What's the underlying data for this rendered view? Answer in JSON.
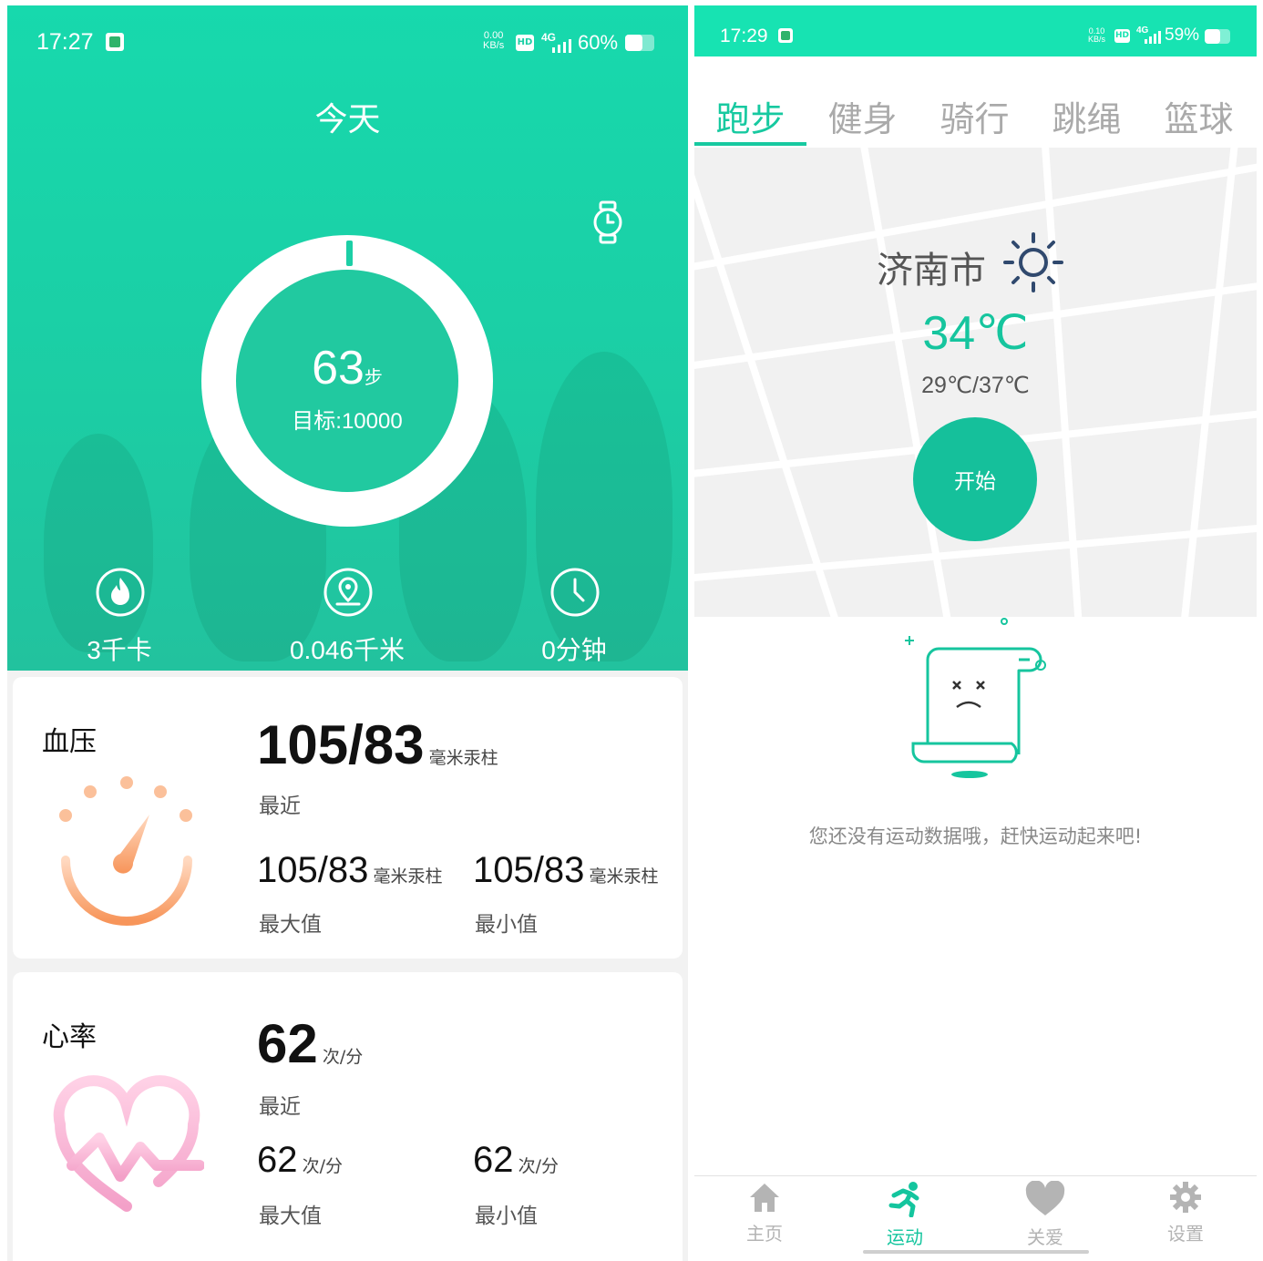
{
  "left": {
    "statusbar": {
      "time": "17:27",
      "speed_top": "0.00",
      "speed_unit": "KB/s",
      "hd": "HD",
      "network": "4G",
      "battery": "60%"
    },
    "header_title": "今天",
    "steps": {
      "value": "63",
      "unit": "步",
      "goal": "目标:10000",
      "progress_fraction": 0.0063
    },
    "stats": [
      {
        "icon": "flame-icon",
        "label": "3千卡"
      },
      {
        "icon": "location-pin-icon",
        "label": "0.046千米"
      },
      {
        "icon": "clock-icon",
        "label": "0分钟"
      }
    ],
    "blood_pressure": {
      "title": "血压",
      "recent_value": "105/83",
      "recent_unit": "毫米汞柱",
      "recent_label": "最近",
      "max_value": "105/83",
      "max_unit": "毫米汞柱",
      "max_label": "最大值",
      "min_value": "105/83",
      "min_unit": "毫米汞柱",
      "min_label": "最小值"
    },
    "heart_rate": {
      "title": "心率",
      "recent_value": "62",
      "recent_unit": "次/分",
      "recent_label": "最近",
      "max_value": "62",
      "max_unit": "次/分",
      "max_label": "最大值",
      "min_value": "62",
      "min_unit": "次/分",
      "min_label": "最小值"
    }
  },
  "right": {
    "statusbar": {
      "time": "17:29",
      "speed_top": "0.10",
      "speed_unit": "KB/s",
      "hd": "HD",
      "network": "4G",
      "battery": "59%"
    },
    "tabs": [
      "跑步",
      "健身",
      "骑行",
      "跳绳",
      "篮球"
    ],
    "active_tab": 0,
    "weather": {
      "city": "济南市",
      "icon": "sun-icon",
      "temp": "34℃",
      "range": "29℃/37℃"
    },
    "start_button": "开始",
    "empty_message": "您还没有运动数据哦，赶快运动起来吧!",
    "nav": [
      {
        "icon": "home-icon",
        "label": "主页"
      },
      {
        "icon": "running-icon",
        "label": "运动"
      },
      {
        "icon": "heart-icon",
        "label": "关爱"
      },
      {
        "icon": "gear-icon",
        "label": "设置"
      }
    ],
    "active_nav": 1
  },
  "colors": {
    "accent": "#17d9ad",
    "accent_dark": "#15c09b",
    "bp_orange": "#f7a06a",
    "hr_pink": "#f5a3c8"
  }
}
